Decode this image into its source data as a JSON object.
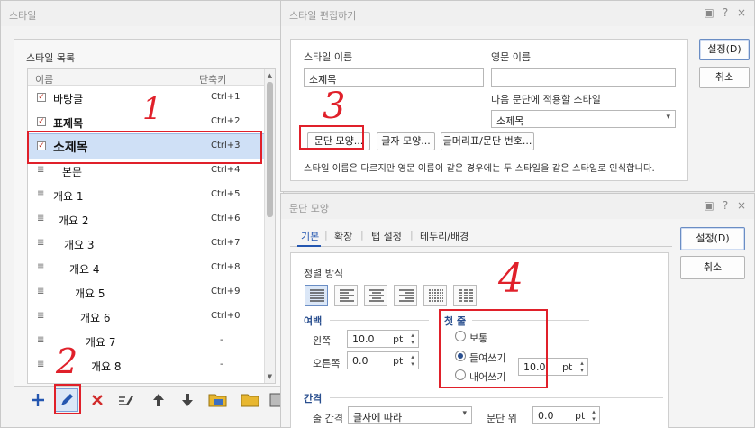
{
  "style_window": {
    "title": "스타일",
    "list_group_label": "스타일 목록",
    "columns": {
      "name": "이름",
      "shortcut": "단축키"
    },
    "items": [
      {
        "name": "바탕글",
        "shortcut": "Ctrl+1",
        "marker": "check"
      },
      {
        "name": "표제목",
        "shortcut": "Ctrl+2",
        "marker": "check"
      },
      {
        "name": "소제목",
        "shortcut": "Ctrl+3",
        "marker": "check",
        "selected": true
      },
      {
        "name": "본문",
        "shortcut": "Ctrl+4",
        "marker": "para"
      },
      {
        "name": "개요 1",
        "shortcut": "Ctrl+5",
        "marker": "para"
      },
      {
        "name": "개요 2",
        "shortcut": "Ctrl+6",
        "marker": "para"
      },
      {
        "name": "개요 3",
        "shortcut": "Ctrl+7",
        "marker": "para"
      },
      {
        "name": "개요 4",
        "shortcut": "Ctrl+8",
        "marker": "para"
      },
      {
        "name": "개요 5",
        "shortcut": "Ctrl+9",
        "marker": "para"
      },
      {
        "name": "개요 6",
        "shortcut": "Ctrl+0",
        "marker": "para"
      },
      {
        "name": "개요 7",
        "shortcut": "-",
        "marker": "para"
      },
      {
        "name": "개요 8",
        "shortcut": "-",
        "marker": "para"
      }
    ],
    "toolbar_icons": [
      "plus-icon",
      "pencil-icon",
      "delete-icon",
      "edit-text-icon",
      "arrow-up-icon",
      "arrow-down-icon",
      "folder-open-icon",
      "folder-icon",
      "save-icon"
    ]
  },
  "edit_dialog": {
    "title": "스타일 편집하기",
    "style_name_label": "스타일 이름",
    "style_name_value": "소제목",
    "english_name_label": "영문 이름",
    "english_name_value": "",
    "next_style_label": "다음 문단에 적용할 스타일",
    "next_style_value": "소제목",
    "buttons": {
      "paragraph_shape": "문단 모양...",
      "char_shape": "글자 모양...",
      "numbering": "글머리표/문단 번호..."
    },
    "note": "스타일 이름은 다르지만 영문 이름이 같은 경우에는 두 스타일을 같은 스타일로 인식합니다.",
    "ok": "설정(D)",
    "cancel": "취소"
  },
  "para_dialog": {
    "title": "문단 모양",
    "tabs": [
      "기본",
      "확장",
      "탭 설정",
      "테두리/배경"
    ],
    "tab_separator": "|",
    "align_label": "정렬 방식",
    "margin_group": "여백",
    "left_label": "왼쪽",
    "left_value": "10.0",
    "right_label": "오른쪽",
    "right_value": "0.0",
    "unit": "pt",
    "first_line_group": "첫 줄",
    "radio_normal": "보통",
    "radio_indent": "들여쓰기",
    "radio_outdent": "내어쓰기",
    "indent_value": "10.0",
    "spacing_group": "간격",
    "line_spacing_label": "줄 간격",
    "line_spacing_value": "글자에 따라",
    "para_above_label": "문단 위",
    "para_above_value": "0.0",
    "ok": "설정(D)",
    "cancel": "취소"
  },
  "annotations": [
    "1",
    "2",
    "3",
    "4"
  ],
  "title_buttons": {
    "help": "?",
    "close": "×"
  },
  "colors": {
    "annotation_red": "#e0202a",
    "selection": "#cfe0f6",
    "accent_blue": "#2456b0"
  }
}
